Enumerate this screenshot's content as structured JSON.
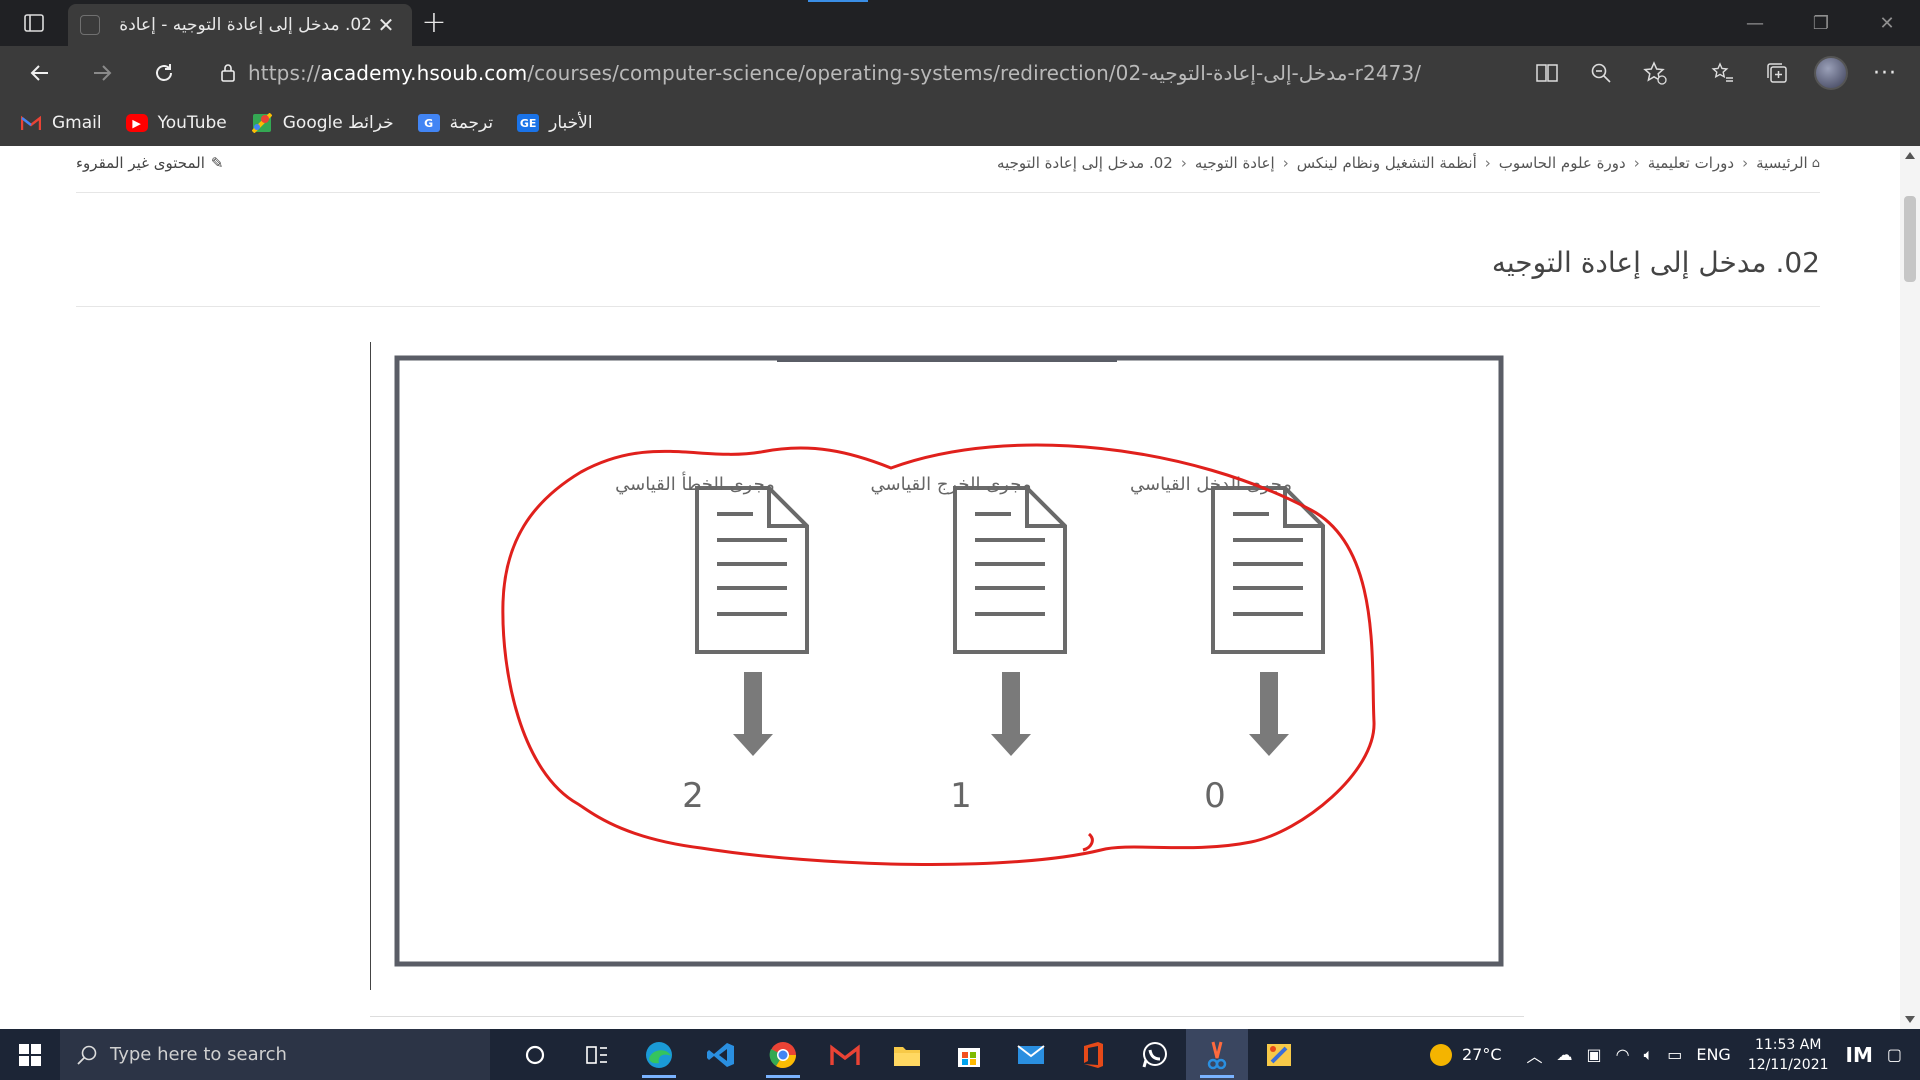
{
  "browser": {
    "tab_title": "02. مدخل إلى إعادة التوجيه - إعادة",
    "url_prefix": "https://",
    "url_host": "academy.hsoub.com",
    "url_path": "/courses/computer-science/operating-systems/redirection/02-مدخل-إلى-إعادة-التوجيه-r2473/",
    "bookmarks": [
      {
        "label": "Gmail",
        "icon": "gmail-icon",
        "color": "#d93025"
      },
      {
        "label": "YouTube",
        "icon": "youtube-icon",
        "color": "#ff0000"
      },
      {
        "label": "Google خرائط",
        "icon": "maps-icon",
        "color": "#34a853"
      },
      {
        "label": "ترجمة",
        "icon": "translate-icon",
        "color": "#4285f4"
      },
      {
        "label": "الأخبار",
        "icon": "news-icon",
        "color": "#4285f4"
      }
    ]
  },
  "page": {
    "breadcrumb": [
      "الرئيسية",
      "دورات تعليمية",
      "دورة علوم الحاسوب",
      "أنظمة التشغيل ونظام لينكس",
      "إعادة التوجيه",
      "02. مدخل إلى إعادة التوجيه"
    ],
    "unread_label": "المحتوى غير المقروء",
    "title": "02. مدخل إلى إعادة التوجيه"
  },
  "figure": {
    "streams": [
      {
        "label": "مجرى الدخل القياسي",
        "number": "0"
      },
      {
        "label": "مجرى الخرج القياسي",
        "number": "1"
      },
      {
        "label": "مجرى الخطأ القياسي",
        "number": "2"
      }
    ],
    "frame_color": "#5a5d66",
    "doc_color": "#6a6a6a",
    "arrow_color": "#7a7a7a",
    "annotation_color": "#e0201c"
  },
  "taskbar": {
    "search_placeholder": "Type here to search",
    "weather": "27°C",
    "language": "ENG",
    "time": "11:53 AM",
    "date": "12/11/2021"
  }
}
